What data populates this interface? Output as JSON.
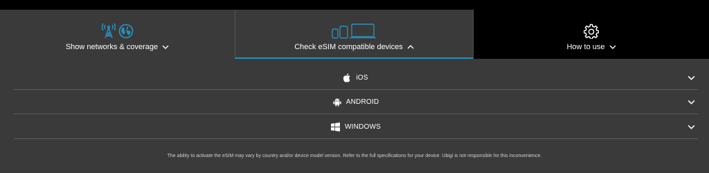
{
  "tabs": [
    {
      "label": "Show networks & coverage",
      "state": "collapsed"
    },
    {
      "label": "Check eSIM compatible devices",
      "state": "expanded"
    },
    {
      "label": "How to use",
      "state": "collapsed"
    }
  ],
  "os_list": [
    {
      "label": "iOS",
      "icon": "apple-icon"
    },
    {
      "label": "ANDROID",
      "icon": "android-icon"
    },
    {
      "label": "WINDOWS",
      "icon": "windows-icon"
    }
  ],
  "disclaimer": "The ability to activate the eSIM may vary by country and/or device model version. Refer to the full specifications for your device. Ubigi is not responsible for this inconvenience.",
  "colors": {
    "accent": "#2a8fb8",
    "panel_bg": "#3a3a3a",
    "page_bg": "#000000"
  }
}
